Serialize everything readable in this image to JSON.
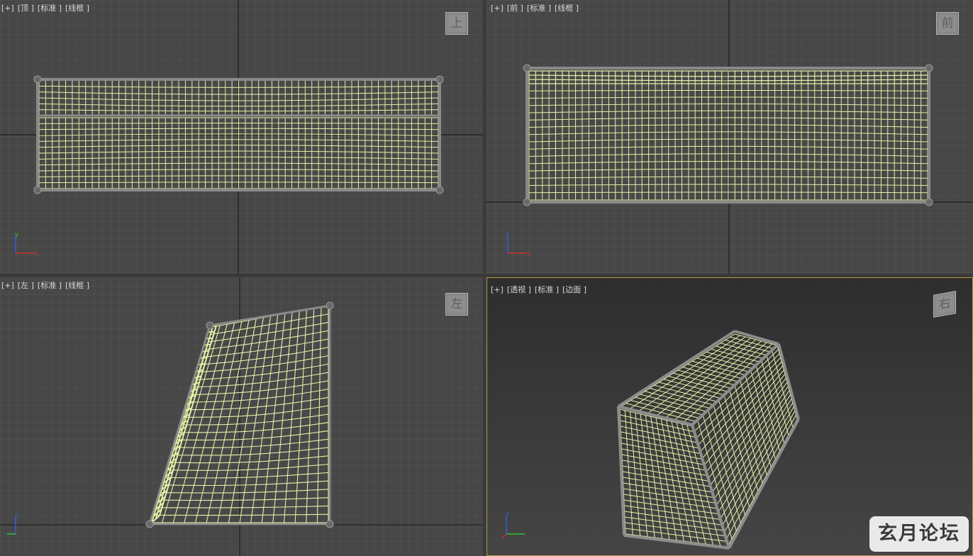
{
  "viewports": {
    "top": {
      "labels": [
        "[+]",
        "[顶 ]",
        "[标准 ]",
        "[线框 ]"
      ],
      "cube": "上"
    },
    "front": {
      "labels": [
        "[+]",
        "[前 ]",
        "[标准 ]",
        "[线框 ]"
      ],
      "cube": "前"
    },
    "left": {
      "labels": [
        "[+]",
        "[左 ]",
        "[标准 ]",
        "[线框 ]"
      ],
      "cube": "左"
    },
    "perspective": {
      "labels": [
        "[+]",
        "[透视 ]",
        "[标准 ]",
        "[边面 ]"
      ],
      "cube": "右"
    }
  },
  "axis_labels": {
    "x": "x",
    "y": "y",
    "z": "z"
  },
  "watermark": "玄月论坛",
  "colors": {
    "grid_bg": "#474747",
    "grid_line": "#555555",
    "grid_major": "#1e1e1e",
    "net_wire": "#e8f0a8",
    "frame": "#8a8a8a",
    "axis_x": "#d03030",
    "axis_y": "#30c030",
    "axis_z": "#3060e0",
    "active_border": "#b89a43"
  }
}
